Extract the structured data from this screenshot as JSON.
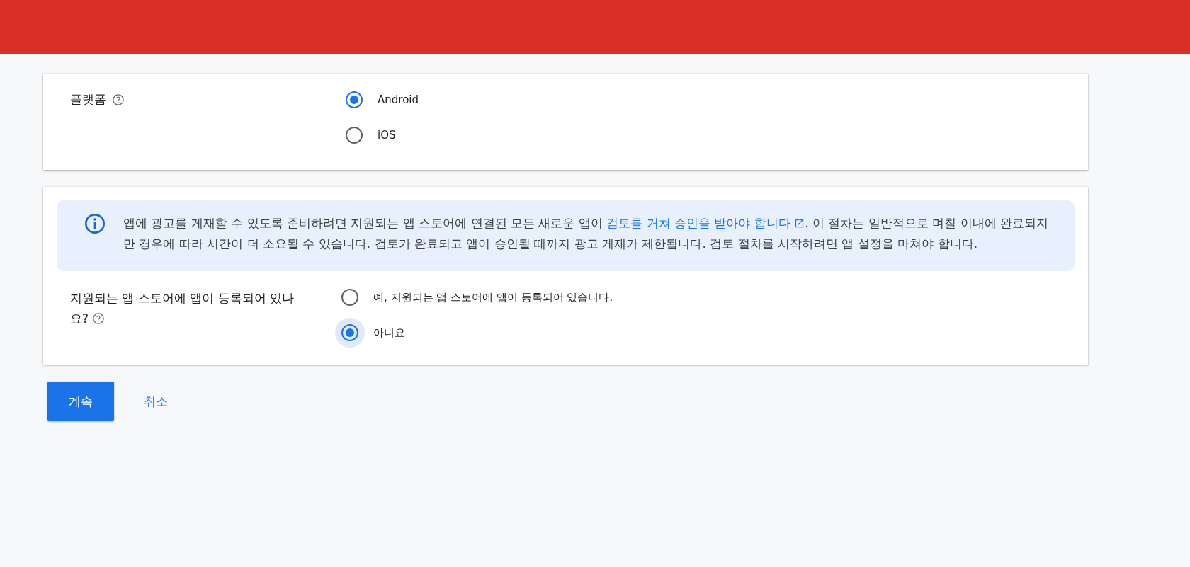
{
  "platform_card": {
    "label": "플랫폼",
    "options": [
      {
        "label": "Android",
        "selected": true,
        "focused": false
      },
      {
        "label": "iOS",
        "selected": false,
        "focused": false
      }
    ]
  },
  "store_card": {
    "notice": {
      "text_before": "앱에 광고를 게재할 수 있도록 준비하려면 지원되는 앱 스토어에 연결된 모든 새로운 앱이 ",
      "link": "검토를 거쳐 승인을 받아야 합니다",
      "text_after": ". 이 절차는 일반적으로 며칠 이내에 완료되지만 경우에 따라 시간이 더 소요될 수 있습니다. 검토가 완료되고 앱이 승인될 때까지 광고 게재가 제한됩니다. 검토 절차를 시작하려면 앱 설정을 마쳐야 합니다."
    },
    "label": "지원되는 앱 스토어에 앱이 등록되어 있나요?",
    "options": [
      {
        "label": "예, 지원되는 앱 스토어에 앱이 등록되어 있습니다.",
        "selected": false,
        "focused": false
      },
      {
        "label": "아니요",
        "selected": true,
        "focused": true
      }
    ]
  },
  "buttons": [
    {
      "kind": "primary",
      "label": "계속"
    },
    {
      "kind": "text",
      "label": "취소"
    }
  ]
}
